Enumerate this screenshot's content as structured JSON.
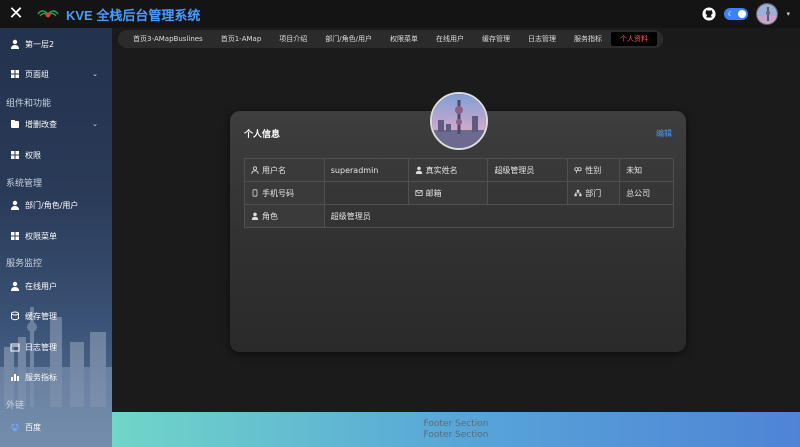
{
  "app": {
    "title": "KVE 全栈后台管理系统"
  },
  "sidebar": {
    "items": [
      {
        "label": "第一层2",
        "icon": "user-icon"
      },
      {
        "label": "页面组",
        "icon": "grid-icon",
        "has_arrow": true
      },
      {
        "group": "组件和功能"
      },
      {
        "label": "增删改查",
        "icon": "folder-icon",
        "has_arrow": true
      },
      {
        "label": "权限",
        "icon": "grid-icon"
      },
      {
        "group": "系统管理"
      },
      {
        "label": "部门/角色/用户",
        "icon": "user-icon"
      },
      {
        "label": "权限菜单",
        "icon": "grid-icon"
      },
      {
        "group": "服务监控"
      },
      {
        "label": "在线用户",
        "icon": "user-icon"
      },
      {
        "label": "缓存管理",
        "icon": "database-icon"
      },
      {
        "label": "日志管理",
        "icon": "calendar-icon"
      },
      {
        "label": "服务指标",
        "icon": "chart-icon"
      },
      {
        "group": "外链"
      },
      {
        "label": "百度",
        "icon": "paw-icon"
      }
    ]
  },
  "tabs": [
    {
      "label": "首页3-AMapBuslines"
    },
    {
      "label": "首页1-AMap"
    },
    {
      "label": "项目介绍"
    },
    {
      "label": "部门/角色/用户"
    },
    {
      "label": "权限菜单"
    },
    {
      "label": "在线用户"
    },
    {
      "label": "缓存管理"
    },
    {
      "label": "日志管理"
    },
    {
      "label": "服务指标"
    },
    {
      "label": "个人资料",
      "active": true
    }
  ],
  "profile": {
    "title": "个人信息",
    "edit_label": "编辑",
    "rows": [
      [
        {
          "label": "用户名",
          "icon": "user-icon"
        },
        {
          "value": "superadmin"
        },
        {
          "label": "真实姓名",
          "icon": "user-icon"
        },
        {
          "value": "超级管理员"
        },
        {
          "label": "性别",
          "icon": "gender-icon"
        },
        {
          "value": "未知"
        }
      ],
      [
        {
          "label": "手机号码",
          "icon": "phone-icon"
        },
        {
          "value": ""
        },
        {
          "label": "邮箱",
          "icon": "mail-icon"
        },
        {
          "value": ""
        },
        {
          "label": "部门",
          "icon": "org-icon"
        },
        {
          "value": "总公司"
        }
      ],
      [
        {
          "label": "角色",
          "icon": "user-icon"
        },
        {
          "value": "超级管理员"
        }
      ]
    ]
  },
  "footer": {
    "line1": "Footer Section",
    "line2": "Footer Section"
  },
  "colors": {
    "accent": "#4a9bff",
    "active_tab": "#ff5a5a"
  }
}
